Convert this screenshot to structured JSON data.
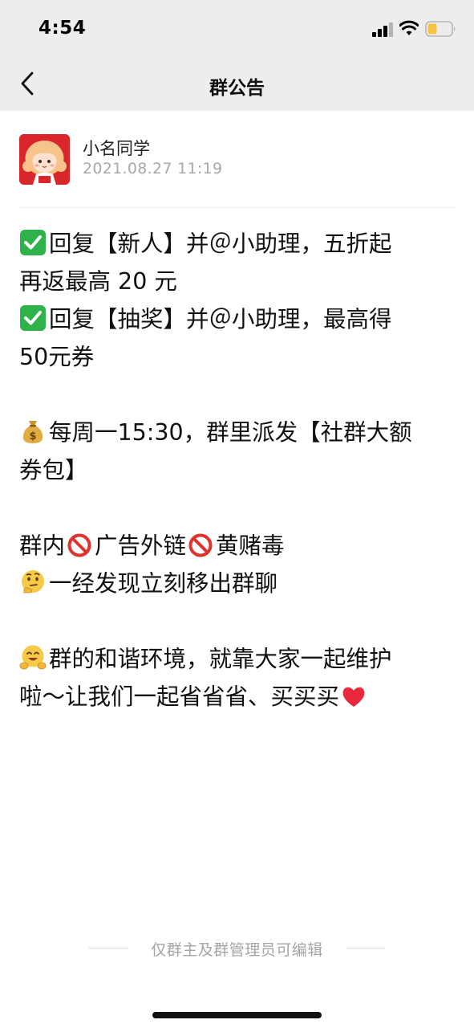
{
  "status_bar": {
    "time": "4:54",
    "icons": [
      "signal-icon",
      "wifi-icon",
      "battery-icon"
    ],
    "battery_color": "#f5c443"
  },
  "nav": {
    "title": "群公告",
    "back_icon": "chevron-left-icon"
  },
  "author": {
    "name": "小名同学",
    "time": "2021.08.27  11:19",
    "avatar_icon": "girl-avatar-icon",
    "avatar_color": "#d8262b"
  },
  "announcement": {
    "lines": [
      "回复【新人】并＠小助理，五折起",
      "再返最高 20 元",
      "回复【抽奖】并＠小助理，最高得",
      "50元券",
      "每周一15:30，群里派发【社群大额",
      "券包】",
      "群内",
      "广告外链",
      "黄赌毒",
      "一经发现立刻移出群聊",
      "群的和谐环境，就靠大家一起维护",
      "啦～让我们一起省省省、买买买"
    ],
    "emoji_icons": [
      "check-mark-icon",
      "money-bag-icon",
      "prohibited-icon",
      "thinking-face-icon",
      "hugging-face-icon",
      "heart-icon"
    ]
  },
  "footer": {
    "note": "仅群主及群管理员可编辑"
  }
}
